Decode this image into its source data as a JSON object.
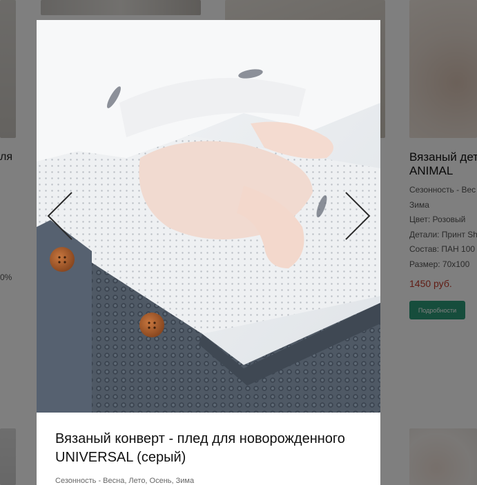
{
  "background": {
    "left_title_fragment": "ля",
    "left_percent_fragment": "0%",
    "right_product": {
      "title_line1": "Вязаный дет",
      "title_line2": "ANIMAL",
      "details": [
        "Сезонность - Вес",
        "Зима",
        "Цвет: Розовый",
        "Детали: Принт Sh",
        "Состав: ПАН 100",
        "Размер: 70х100"
      ],
      "price": "1450 руб.",
      "button_label": "Подробности"
    }
  },
  "modal": {
    "title": "Вязаный конверт - плед для новорожденного UNIVERSAL (серый)",
    "season": "Сезонность - Весна, Лето, Осень, Зима",
    "nav": {
      "prev_icon": "chevron-left-icon",
      "next_icon": "chevron-right-icon"
    }
  },
  "colors": {
    "overlay": "rgba(0,0,0,0.5)",
    "accent_button": "#2d9a78",
    "price": "#c23b2b"
  }
}
